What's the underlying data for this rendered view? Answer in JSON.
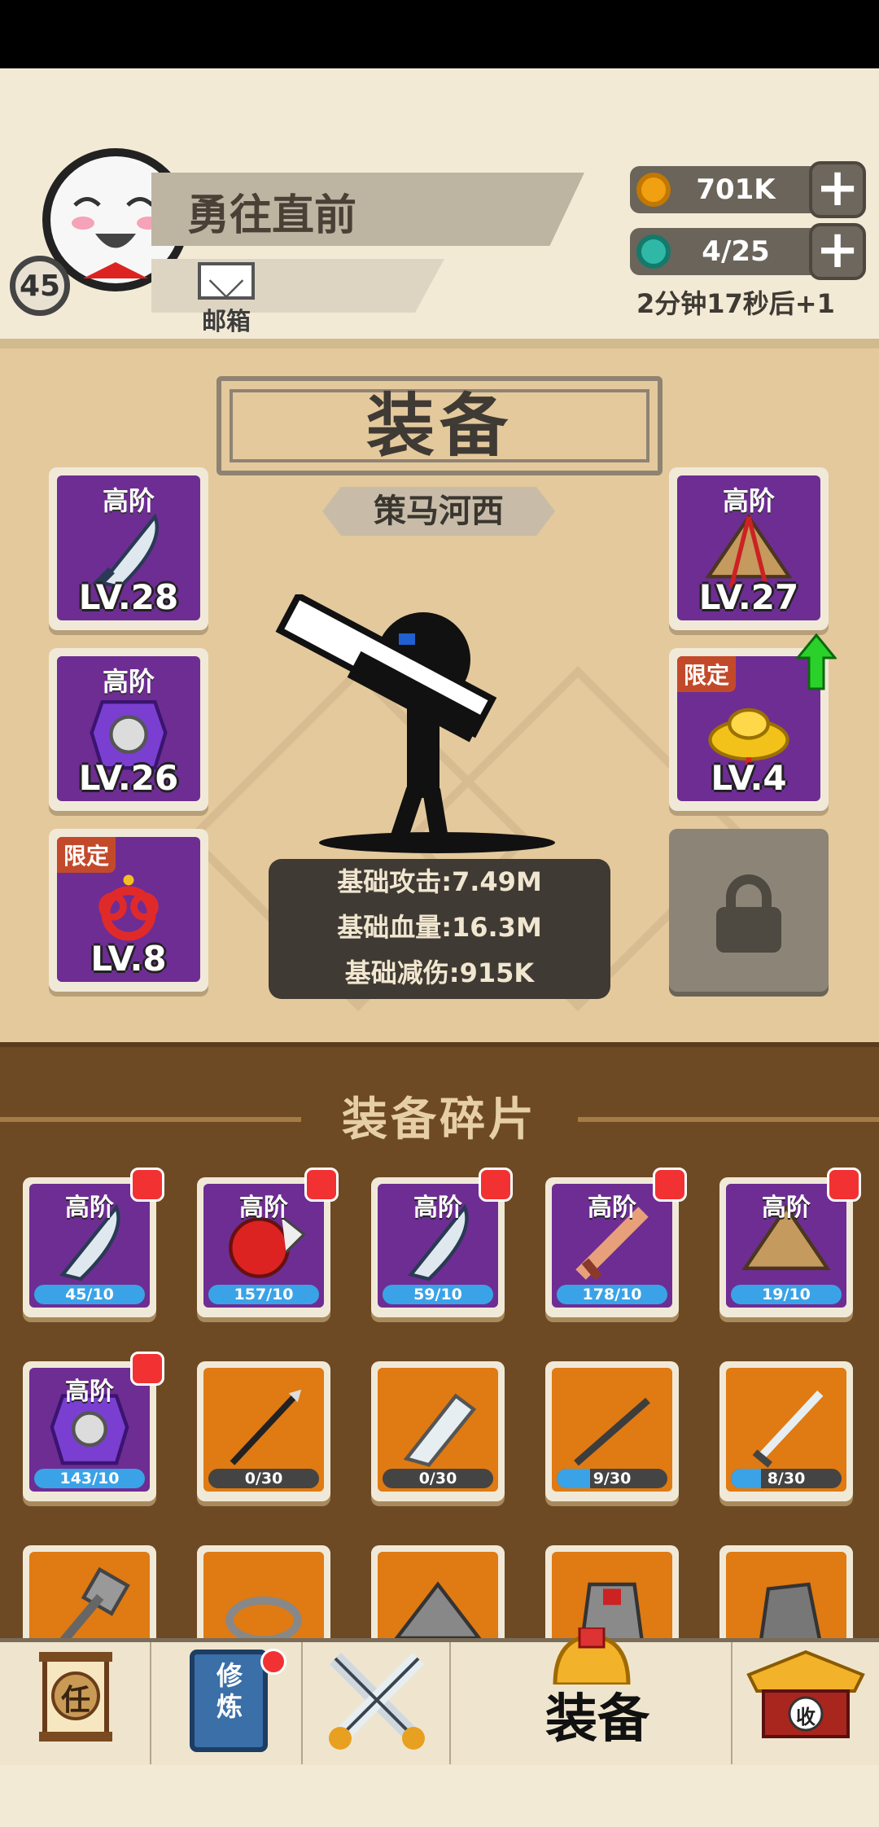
{
  "player": {
    "name": "勇往直前",
    "level": "45",
    "mail_label": "邮箱"
  },
  "resources": {
    "gold": "701K",
    "energy": "4/25",
    "energy_timer": "2分钟17秒后+1"
  },
  "equipment": {
    "title": "装备",
    "set_name": "策马河西",
    "slots": [
      {
        "badge": "高阶",
        "level": "LV.28",
        "item": "broadsword-icon"
      },
      {
        "badge": "高阶",
        "level": "LV.26",
        "item": "armor-icon"
      },
      {
        "badge": "限定",
        "level": "LV.8",
        "item": "chinese-knot-icon"
      },
      {
        "badge": "高阶",
        "level": "LV.27",
        "item": "straw-hat-icon"
      },
      {
        "badge": "限定",
        "level": "LV.4",
        "item": "gold-ingot-icon"
      }
    ],
    "stats": [
      "基础攻击:7.49M",
      "基础血量:16.3M",
      "基础减伤:915K"
    ]
  },
  "fragments": {
    "title": "装备碎片",
    "items": [
      {
        "badge": "高阶",
        "count": "45/10",
        "progress": 1.0,
        "bg": "#6e2d93",
        "item": "broadsword-icon",
        "alert": true
      },
      {
        "badge": "高阶",
        "count": "157/10",
        "progress": 1.0,
        "bg": "#6e2d93",
        "item": "red-helmet-icon",
        "alert": true
      },
      {
        "badge": "高阶",
        "count": "59/10",
        "progress": 1.0,
        "bg": "#6e2d93",
        "item": "broadsword-icon",
        "alert": true
      },
      {
        "badge": "高阶",
        "count": "178/10",
        "progress": 1.0,
        "bg": "#6e2d93",
        "item": "wooden-sword-icon",
        "alert": true
      },
      {
        "badge": "高阶",
        "count": "19/10",
        "progress": 1.0,
        "bg": "#6e2d93",
        "item": "straw-hat-icon",
        "alert": true
      },
      {
        "badge": "高阶",
        "count": "143/10",
        "progress": 1.0,
        "bg": "#6e2d93",
        "item": "armor-icon",
        "alert": true
      },
      {
        "badge": "",
        "count": "0/30",
        "progress": 0.0,
        "bg": "#e07a12",
        "item": "trident-spear-icon",
        "alert": false
      },
      {
        "badge": "",
        "count": "0/30",
        "progress": 0.0,
        "bg": "#e07a12",
        "item": "cleaver-icon",
        "alert": false
      },
      {
        "badge": "",
        "count": "9/30",
        "progress": 0.3,
        "bg": "#e07a12",
        "item": "staff-icon",
        "alert": false
      },
      {
        "badge": "",
        "count": "8/30",
        "progress": 0.27,
        "bg": "#e07a12",
        "item": "long-sword-icon",
        "alert": false
      },
      {
        "badge": "",
        "count": "",
        "progress": 0.0,
        "bg": "#e07a12",
        "item": "hammer-icon",
        "alert": false
      },
      {
        "badge": "",
        "count": "",
        "progress": 0.0,
        "bg": "#e07a12",
        "item": "bracelet-icon",
        "alert": false
      },
      {
        "badge": "",
        "count": "",
        "progress": 0.0,
        "bg": "#e07a12",
        "item": "hat-icon",
        "alert": false
      },
      {
        "badge": "",
        "count": "",
        "progress": 0.0,
        "bg": "#e07a12",
        "item": "vest-icon",
        "alert": false
      },
      {
        "badge": "",
        "count": "",
        "progress": 0.0,
        "bg": "#e07a12",
        "item": "cloak-icon",
        "alert": false
      }
    ]
  },
  "tabs": [
    {
      "label": "任",
      "icon": "scroll-icon"
    },
    {
      "label": "修炼",
      "icon": "book-icon"
    },
    {
      "label": "",
      "icon": "crossed-swords-icon"
    },
    {
      "label": "装备",
      "icon": "helmet-icon"
    },
    {
      "label": "收",
      "icon": "building-icon"
    }
  ],
  "colors": {
    "purple": "#6e2d93",
    "orange": "#e07a12",
    "accent_red": "#f23232",
    "progress_blue": "#3aa3e8"
  }
}
